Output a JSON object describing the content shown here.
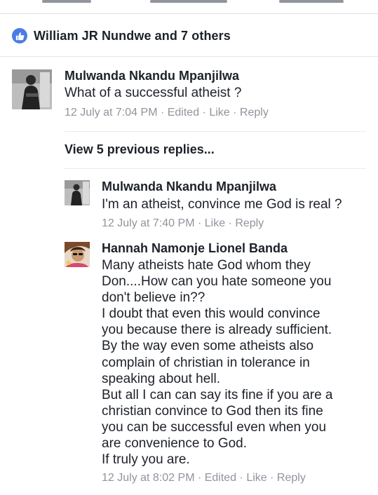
{
  "likes": {
    "summary": "William JR Nundwe and 7 others"
  },
  "comment_main": {
    "author": "Mulwanda Nkandu Mpanjilwa",
    "text": "What of a successful atheist ?",
    "timestamp": "12 July at 7:04 PM",
    "edited": "Edited",
    "like": "Like",
    "reply": "Reply",
    "dot": " · "
  },
  "view_previous": "View 5 previous replies...",
  "replies": [
    {
      "author": "Mulwanda Nkandu Mpanjilwa",
      "text": "I'm an atheist, convince me God is real ?",
      "timestamp": "12 July at 7:40 PM",
      "like": "Like",
      "reply": "Reply"
    },
    {
      "author": "Hannah Namonje Lionel Banda",
      "text": "Many atheists hate God whom they\nDon....How can you hate someone you\ndon't believe in??\nI doubt that even this would convince\nyou because there is already sufficient.\nBy the way even some atheists also\ncomplain of christian in tolerance in\nspeaking about hell.\nBut all I can can say its fine if you are a\nchristian convince to God then its fine\nyou can be successful even when you\nare convenience to God.\nIf truly you are.",
      "timestamp": "12 July at 8:02 PM",
      "edited": "Edited",
      "like": "Like",
      "reply": "Reply"
    }
  ],
  "colors": {
    "like_blue": "#4a7ce2",
    "meta_grey": "#90949c",
    "text_dark": "#1d2129"
  }
}
